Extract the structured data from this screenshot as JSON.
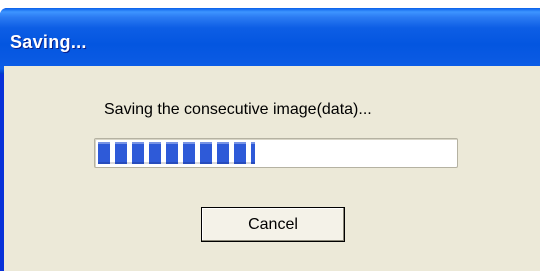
{
  "window": {
    "title": "Saving..."
  },
  "dialog": {
    "message": "Saving the consecutive image(data)...",
    "progress": {
      "fraction": 0.44,
      "segment_color": "#2e5ad8"
    },
    "cancel_button": {
      "label": "Cancel"
    }
  },
  "colors": {
    "title_bar": "#0456e0",
    "client_background": "#ece9d8",
    "title_text": "#ffffff"
  }
}
